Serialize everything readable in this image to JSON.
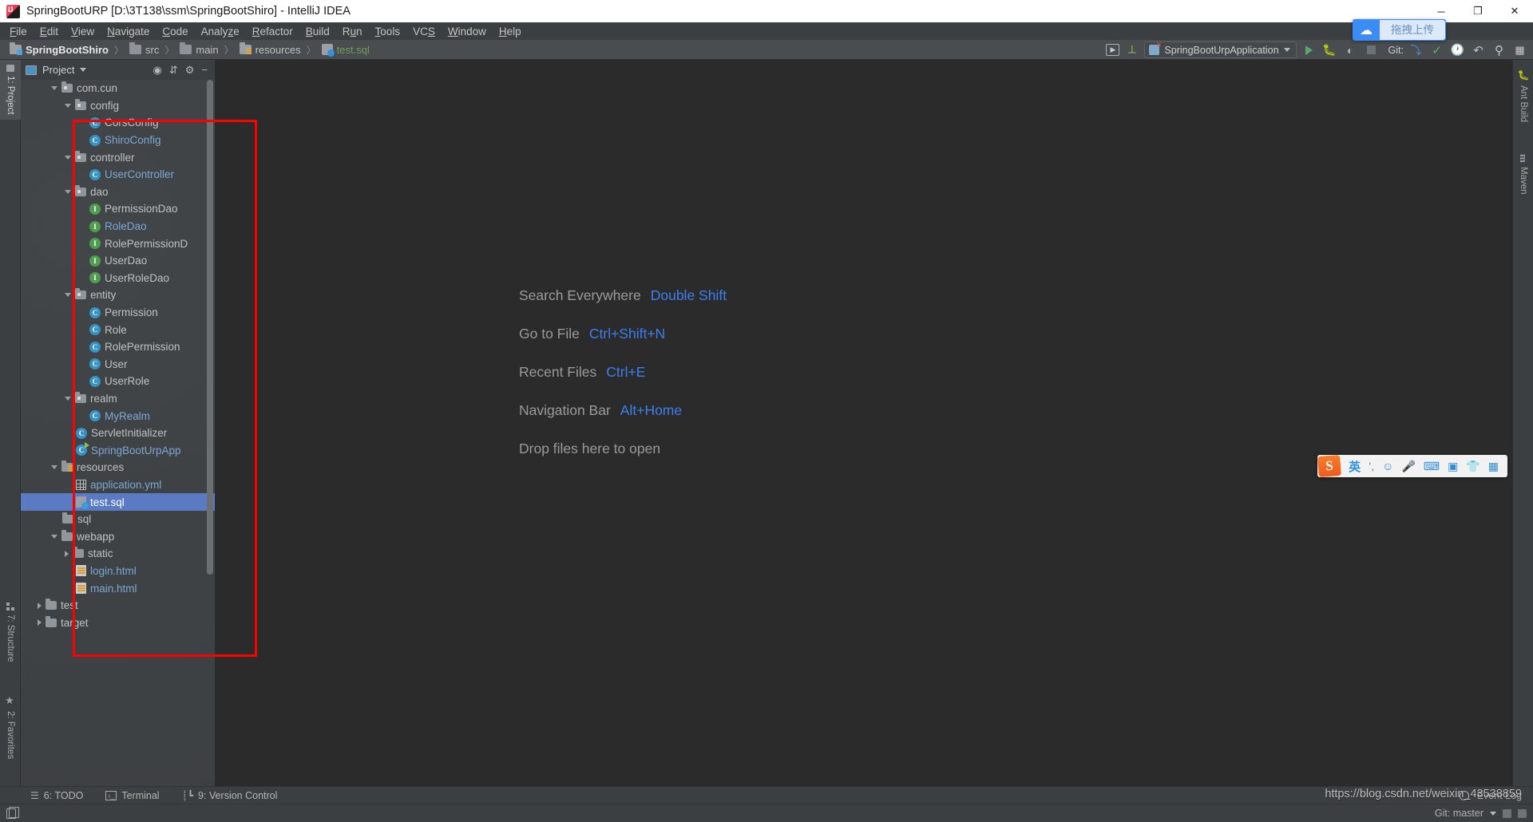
{
  "titlebar": {
    "title": "SpringBootURP [D:\\3T138\\ssm\\SpringBootShiro] - IntelliJ IDEA",
    "logo_icon": "intellij-idea-logo",
    "minimize": "─",
    "maximize": "❐",
    "close": "✕"
  },
  "menubar": {
    "items": [
      {
        "label": "File",
        "mnemonic": "F"
      },
      {
        "label": "Edit",
        "mnemonic": "E"
      },
      {
        "label": "View",
        "mnemonic": "V"
      },
      {
        "label": "Navigate",
        "mnemonic": "N"
      },
      {
        "label": "Code",
        "mnemonic": "C"
      },
      {
        "label": "Analyze",
        "mnemonic": "z"
      },
      {
        "label": "Refactor",
        "mnemonic": "R"
      },
      {
        "label": "Build",
        "mnemonic": "B"
      },
      {
        "label": "Run",
        "mnemonic": "n"
      },
      {
        "label": "Tools",
        "mnemonic": "T"
      },
      {
        "label": "VCS",
        "mnemonic": "S"
      },
      {
        "label": "Window",
        "mnemonic": "W"
      },
      {
        "label": "Help",
        "mnemonic": "H"
      }
    ]
  },
  "breadcrumb": {
    "items": [
      {
        "label": "SpringBootShiro",
        "icon": "module-folder-icon",
        "style": "bold"
      },
      {
        "label": "src",
        "icon": "folder-icon",
        "style": "plain"
      },
      {
        "label": "main",
        "icon": "folder-icon",
        "style": "plain"
      },
      {
        "label": "resources",
        "icon": "resources-folder-icon",
        "style": "plain"
      },
      {
        "label": "test.sql",
        "icon": "sql-file-icon",
        "style": "file"
      }
    ],
    "separator": "〉"
  },
  "toolbar": {
    "open_tool_window_icon": "open-tool-window-icon",
    "build_icon": "build-hammer-icon",
    "run_config_name": "SpringBootUrpApplication",
    "run_config_dropdown_icon": "chevron-down-icon",
    "run_icon": "run-play-icon",
    "debug_icon": "debug-bug-icon",
    "coverage_icon": "run-with-coverage-icon",
    "stop_icon": "stop-icon",
    "git_label": "Git:",
    "git_update_icon": "vcs-update-icon",
    "git_commit_icon": "vcs-commit-icon",
    "git_history_icon": "vcs-history-icon",
    "git_rollback_icon": "vcs-rollback-icon",
    "search_icon": "search-everywhere-icon",
    "layout_icon": "restore-layout-icon"
  },
  "netdisk_widget": {
    "logo_icon": "baidu-netdisk-icon",
    "label": "拖拽上传"
  },
  "left_rail": {
    "project": "1: Project",
    "structure": "7: Structure",
    "favorites": "2: Favorites"
  },
  "right_rail": {
    "ant_build": "Ant Build",
    "maven": "Maven"
  },
  "project_panel": {
    "title": "Project",
    "dropdown_icon": "chevron-down-icon",
    "locate_icon": "scroll-from-source-icon",
    "collapse_icon": "collapse-all-icon",
    "settings_icon": "gear-icon",
    "hide_icon": "hide-icon",
    "tree": [
      {
        "label": "com.cun",
        "icon": "package-icon",
        "indent": 1,
        "arrow": "down",
        "style": "plain"
      },
      {
        "label": "config",
        "icon": "package-icon",
        "indent": 2,
        "arrow": "down",
        "style": "plain"
      },
      {
        "label": "CorsConfig",
        "icon": "class-icon",
        "indent": 3,
        "arrow": "none",
        "style": "plain"
      },
      {
        "label": "ShiroConfig",
        "icon": "class-icon",
        "indent": 3,
        "arrow": "none",
        "style": "blue"
      },
      {
        "label": "controller",
        "icon": "package-icon",
        "indent": 2,
        "arrow": "down",
        "style": "plain"
      },
      {
        "label": "UserController",
        "icon": "class-icon",
        "indent": 3,
        "arrow": "none",
        "style": "blue"
      },
      {
        "label": "dao",
        "icon": "package-icon",
        "indent": 2,
        "arrow": "down",
        "style": "plain"
      },
      {
        "label": "PermissionDao",
        "icon": "interface-icon",
        "indent": 3,
        "arrow": "none",
        "style": "plain"
      },
      {
        "label": "RoleDao",
        "icon": "interface-icon",
        "indent": 3,
        "arrow": "none",
        "style": "blue"
      },
      {
        "label": "RolePermissionD",
        "icon": "interface-icon",
        "indent": 3,
        "arrow": "none",
        "style": "plain"
      },
      {
        "label": "UserDao",
        "icon": "interface-icon",
        "indent": 3,
        "arrow": "none",
        "style": "plain"
      },
      {
        "label": "UserRoleDao",
        "icon": "interface-icon",
        "indent": 3,
        "arrow": "none",
        "style": "plain"
      },
      {
        "label": "entity",
        "icon": "package-icon",
        "indent": 2,
        "arrow": "down",
        "style": "plain"
      },
      {
        "label": "Permission",
        "icon": "class-icon",
        "indent": 3,
        "arrow": "none",
        "style": "plain"
      },
      {
        "label": "Role",
        "icon": "class-icon",
        "indent": 3,
        "arrow": "none",
        "style": "plain"
      },
      {
        "label": "RolePermission",
        "icon": "class-icon",
        "indent": 3,
        "arrow": "none",
        "style": "plain"
      },
      {
        "label": "User",
        "icon": "class-icon",
        "indent": 3,
        "arrow": "none",
        "style": "plain"
      },
      {
        "label": "UserRole",
        "icon": "class-icon",
        "indent": 3,
        "arrow": "none",
        "style": "plain"
      },
      {
        "label": "realm",
        "icon": "package-icon",
        "indent": 2,
        "arrow": "down",
        "style": "plain"
      },
      {
        "label": "MyRealm",
        "icon": "class-icon",
        "indent": 3,
        "arrow": "none",
        "style": "blue"
      },
      {
        "label": "ServletInitializer",
        "icon": "class-icon",
        "indent": 2,
        "arrow": "none",
        "style": "plain"
      },
      {
        "label": "SpringBootUrpApp",
        "icon": "runnable-class-icon",
        "indent": 2,
        "arrow": "none",
        "style": "blue"
      },
      {
        "label": "resources",
        "icon": "resources-folder-icon",
        "indent": 1,
        "arrow": "down",
        "style": "plain"
      },
      {
        "label": "application.yml",
        "icon": "yaml-file-icon",
        "indent": 2,
        "arrow": "none",
        "style": "blue"
      },
      {
        "label": "test.sql",
        "icon": "sql-file-icon",
        "indent": 2,
        "arrow": "none",
        "style": "plain",
        "selected": true
      },
      {
        "label": "sql",
        "icon": "folder-icon",
        "indent": 1,
        "arrow": "none",
        "style": "plain"
      },
      {
        "label": "webapp",
        "icon": "folder-icon",
        "indent": 1,
        "arrow": "down",
        "style": "plain"
      },
      {
        "label": "static",
        "icon": "folder-icon",
        "indent": 2,
        "arrow": "right",
        "style": "plain"
      },
      {
        "label": "login.html",
        "icon": "html-file-icon",
        "indent": 2,
        "arrow": "none",
        "style": "blue"
      },
      {
        "label": "main.html",
        "icon": "html-file-icon",
        "indent": 2,
        "arrow": "none",
        "style": "blue"
      },
      {
        "label": "test",
        "icon": "folder-icon",
        "indent": 0,
        "arrow": "right",
        "style": "plain"
      },
      {
        "label": "target",
        "icon": "folder-icon",
        "indent": 0,
        "arrow": "right",
        "style": "plain"
      }
    ]
  },
  "editor": {
    "tips": [
      {
        "label": "Search Everywhere",
        "key": "Double Shift"
      },
      {
        "label": "Go to File",
        "key": "Ctrl+Shift+N"
      },
      {
        "label": "Recent Files",
        "key": "Ctrl+E"
      },
      {
        "label": "Navigation Bar",
        "key": "Alt+Home"
      },
      {
        "label": "Drop files here to open",
        "key": ""
      }
    ]
  },
  "sogou_bar": {
    "logo": "S",
    "mode": "英",
    "punctuation_icon": "punctuation-icon",
    "emoji_icon": "emoji-icon",
    "mic_icon": "microphone-icon",
    "keyboard_icon": "soft-keyboard-icon",
    "card_icon": "id-card-icon",
    "skin_icon": "skin-shirt-icon",
    "toolbox_icon": "toolbox-grid-icon"
  },
  "bottom_bar": {
    "todo": "6: TODO",
    "todo_icon": "todo-list-icon",
    "terminal": "Terminal",
    "terminal_icon": "terminal-icon",
    "version_control": "9: Version Control",
    "version_control_icon": "vcs-branch-icon",
    "event_log": "Event Log",
    "event_log_icon": "event-log-icon"
  },
  "status_bar": {
    "doc_icon": "document-icon",
    "git_branch": "Git: master",
    "git_dropdown_icon": "chevron-down-icon"
  },
  "watermark": {
    "text": "https://blog.csdn.net/weixin_43538859"
  },
  "colors": {
    "accent_blue": "#3d7ef0",
    "selection": "#5a7ac4",
    "annotation_red": "#ff0000",
    "editor_bg": "#2b2b2b",
    "panel_bg": "#3c3f41"
  }
}
